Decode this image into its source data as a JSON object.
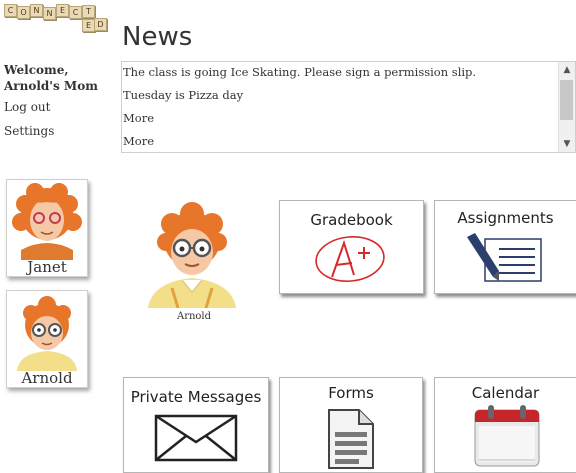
{
  "logo": {
    "letters": [
      "C",
      "O",
      "N",
      "N",
      "E",
      "C",
      "T",
      "E",
      "D"
    ]
  },
  "sidebar": {
    "welcome": "Welcome, Arnold's Mom",
    "logout": "Log out",
    "settings": "Settings"
  },
  "page_title": "News",
  "news": {
    "items": [
      "The class is going Ice Skating. Please sign a permission slip.",
      "Tuesday is Pizza day",
      "More",
      "More"
    ]
  },
  "students": [
    {
      "name": "Janet"
    },
    {
      "name": "Arnold"
    }
  ],
  "selected_student": {
    "name": "Arnold"
  },
  "tiles": {
    "gradebook": "Gradebook",
    "assignments": "Assignments",
    "private_messages": "Private Messages",
    "forms": "Forms",
    "calendar": "Calendar"
  },
  "icons": {
    "gradebook": "a-plus-grade-icon",
    "assignments": "pencil-list-icon",
    "private_messages": "envelope-icon",
    "forms": "document-icon",
    "calendar": "calendar-icon"
  },
  "colors": {
    "grade_red": "#d42a2a",
    "calendar_red": "#c6262b",
    "assignments_blue": "#2a3f6b"
  }
}
